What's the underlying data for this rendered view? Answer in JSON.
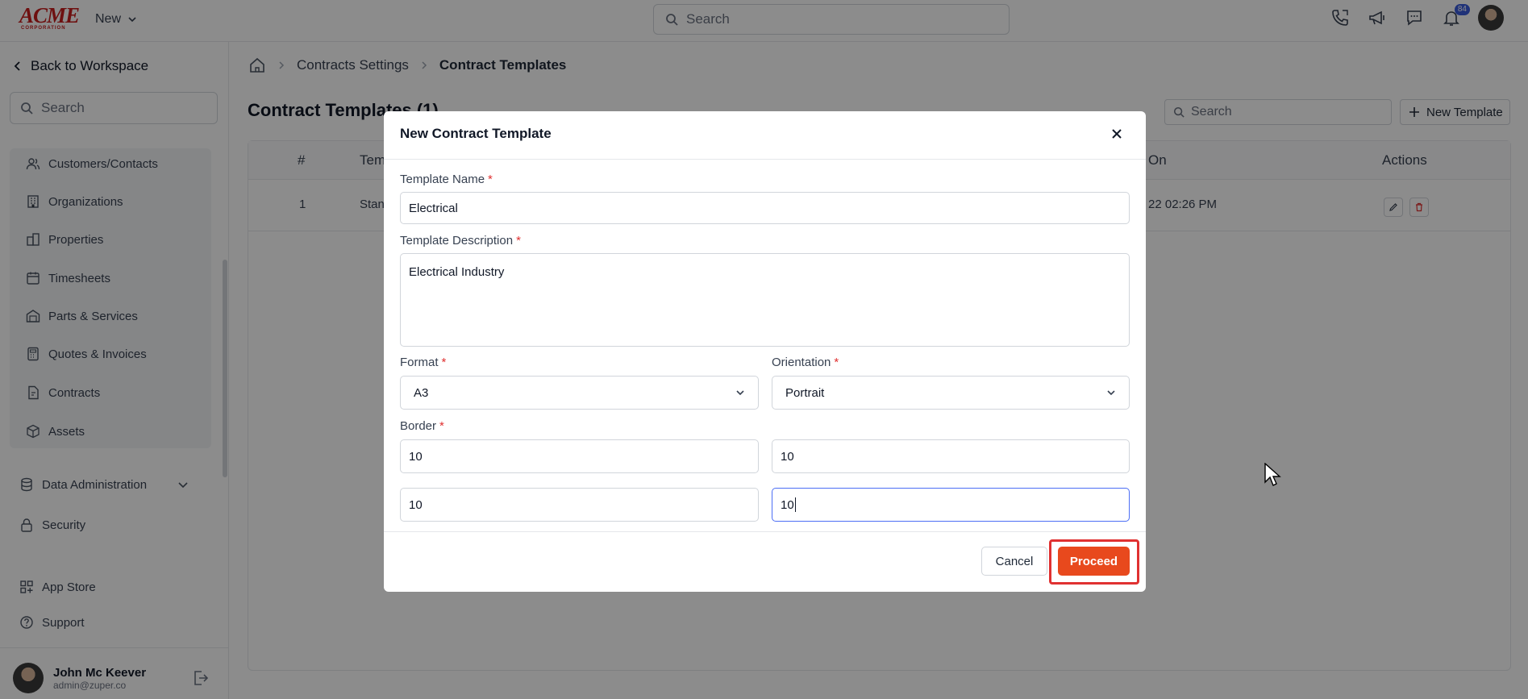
{
  "topbar": {
    "logo_text": "ACME",
    "logo_subtext": "CORPORATION",
    "new_label": "New",
    "search_placeholder": "Search",
    "notification_count": "84",
    "icons": [
      "phone-icon",
      "megaphone-icon",
      "chat-icon",
      "bell-icon",
      "avatar"
    ]
  },
  "sidebar": {
    "back_label": "Back to Workspace",
    "search_placeholder": "Search",
    "items": [
      {
        "label": "Customers/Contacts",
        "icon": "contacts-icon"
      },
      {
        "label": "Organizations",
        "icon": "building-icon"
      },
      {
        "label": "Properties",
        "icon": "property-icon"
      },
      {
        "label": "Timesheets",
        "icon": "calendar-icon"
      },
      {
        "label": "Parts & Services",
        "icon": "warehouse-icon"
      },
      {
        "label": "Quotes & Invoices",
        "icon": "calculator-icon"
      },
      {
        "label": "Contracts",
        "icon": "contract-icon"
      },
      {
        "label": "Assets",
        "icon": "cube-icon"
      }
    ],
    "data_admin_label": "Data Administration",
    "security_label": "Security",
    "app_store_label": "App Store",
    "support_label": "Support",
    "user": {
      "name": "John Mc Keever",
      "email": "admin@zuper.co"
    }
  },
  "breadcrumb": {
    "home": "home-icon",
    "level1": "Contracts Settings",
    "level2": "Contract Templates"
  },
  "page": {
    "title": "Contract Templates (1)",
    "search_placeholder": "Search",
    "new_template_label": "New Template"
  },
  "table": {
    "headers": {
      "num": "#",
      "name": "Tem",
      "created_on": "On",
      "actions": "Actions"
    },
    "rows": [
      {
        "num": "1",
        "name": "Stan",
        "created_on": "22 02:26 PM"
      }
    ]
  },
  "modal": {
    "title": "New Contract Template",
    "template_name_label": "Template Name",
    "template_name_value": "Electrical",
    "description_label": "Template Description",
    "description_value": "Electrical Industry",
    "format_label": "Format",
    "format_value": "A3",
    "orientation_label": "Orientation",
    "orientation_value": "Portrait",
    "border_label": "Border",
    "border_values": [
      "10",
      "10",
      "10",
      "10"
    ],
    "cancel_label": "Cancel",
    "proceed_label": "Proceed",
    "required_mark": "*"
  },
  "colors": {
    "accent": "#e8491d",
    "highlight": "#e03131",
    "focus": "#4c6ef5",
    "badge": "#3b5bdb"
  }
}
